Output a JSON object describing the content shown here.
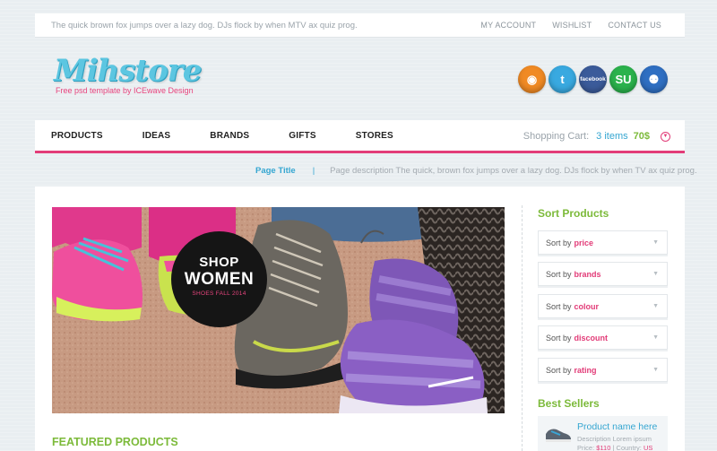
{
  "topbar": {
    "tagline": "The quick brown fox jumps over a lazy dog. DJs flock by when MTV ax quiz prog.",
    "links": [
      "MY ACCOUNT",
      "WISHLIST",
      "CONTACT US"
    ]
  },
  "brand": {
    "name": "Mihstore",
    "subtitle": "Free psd template by ICEwave Design",
    "colors": {
      "accent_pink": "#e23c78",
      "accent_blue": "#35a6d1",
      "accent_green": "#7cba3a"
    }
  },
  "social": [
    {
      "name": "rss-icon",
      "glyph": "◉",
      "color": "#f08a24"
    },
    {
      "name": "twitter-icon",
      "glyph": "t",
      "color": "#39a9e0"
    },
    {
      "name": "facebook-icon",
      "glyph": "facebook",
      "color": "#3b5b9a"
    },
    {
      "name": "stumbleupon-icon",
      "glyph": "SU",
      "color": "#2bb24c"
    },
    {
      "name": "myspace-icon",
      "glyph": "⚉",
      "color": "#2f6fc2"
    }
  ],
  "nav": {
    "items": [
      "PRODUCTS",
      "IDEAS",
      "BRANDS",
      "GIFTS",
      "STORES"
    ],
    "cart": {
      "label": "Shopping Cart:",
      "items": "3 items",
      "price": "70$",
      "caret": "▼"
    }
  },
  "page": {
    "title": "Page Title",
    "separator": "|",
    "description": "Page description The quick, brown fox jumps over a lazy dog. DJs flock by when TV ax quiz prog."
  },
  "hero": {
    "badge_line1": "SHOP",
    "badge_line2": "WOMEN",
    "badge_line3": "SHOES FALL 2014"
  },
  "featured": {
    "title": "FEATURED PRODUCTS"
  },
  "sort": {
    "title": "Sort Products",
    "by_label": "Sort by",
    "options": [
      "price",
      "brands",
      "colour",
      "discount",
      "rating"
    ],
    "arrow": "▼"
  },
  "best": {
    "title": "Best Sellers",
    "item": {
      "name": "Product name here",
      "description": "Description Lorem ipsum",
      "price_label": "Price:",
      "price": "$110",
      "country_label": "Country:",
      "country": "US"
    }
  }
}
